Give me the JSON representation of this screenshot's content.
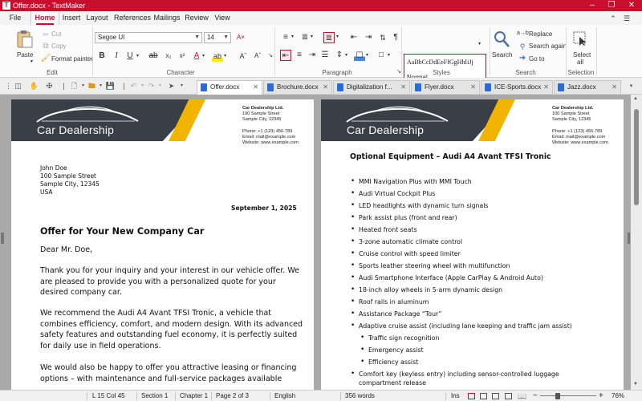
{
  "window": {
    "title": "Offer.docx - TextMaker",
    "app_icon": "T",
    "controls": [
      "–",
      "❐",
      "✕"
    ]
  },
  "menu": {
    "tabs": [
      "File",
      "Home",
      "Insert",
      "Layout",
      "References",
      "Mailings",
      "Review",
      "View"
    ],
    "active": "Home"
  },
  "ribbon": {
    "edit": {
      "paste": "Paste",
      "cut": "Cut",
      "copy": "Copy",
      "format_painter": "Format painter",
      "label": "Edit"
    },
    "character": {
      "font": "Segoe UI",
      "size": "14",
      "label": "Character"
    },
    "paragraph": {
      "label": "Paragraph"
    },
    "styles": {
      "preview": "AaBbCcDdEeFfGgHhIiJj",
      "current": "Normal",
      "label": "Styles"
    },
    "search": {
      "search": "Search",
      "replace": "Replace",
      "search_again": "Search again",
      "goto": "Go to",
      "label": "Search"
    },
    "selection": {
      "select_all_1": "Select",
      "select_all_2": "all",
      "label": "Selection"
    }
  },
  "doc_tabs": [
    "Offer.docx",
    "Brochure.docx",
    "Digitalization f...",
    "Flyer.docx",
    "ICE-Sports.docx",
    "Jazz.docx"
  ],
  "active_doc": "Offer.docx",
  "letterhead": {
    "logo": "Car Dealership",
    "company": "Car Dealership Ltd.",
    "street": "100 Sample Street",
    "city": "Sample City, 12345",
    "phone": "Phone: +1 (123) 456-789",
    "email": "Email: mail@example.com",
    "website": "Website: www.example.com"
  },
  "page1": {
    "recipient": [
      "John Doe",
      "100 Sample Street",
      "Sample City, 12345",
      "USA"
    ],
    "date": "September 1, 2025",
    "heading": "Offer for Your New Company Car",
    "salutation": "Dear Mr. Doe,",
    "p1": [
      "Thank you for your inquiry and your interest in our vehicle offer. We",
      "are pleased to provide you with a personalized quote for your",
      "desired company car."
    ],
    "p2": [
      "We recommend the Audi A4 Avant TFSI Tronic, a vehicle that",
      "combines efficiency, comfort, and modern design. With its advanced",
      "safety features and outstanding fuel economy, it is perfectly suited",
      "for daily use in field operations."
    ],
    "p3": [
      "We would also be happy to offer you attractive leasing or financing",
      "options – with maintenance and full-service packages available"
    ]
  },
  "page2": {
    "heading": "Optional Equipment – Audi A4 Avant TFSI Tronic",
    "items": [
      "MMI Navigation Plus with MMI Touch",
      "Audi Virtual Cockpit Plus",
      "LED headlights with dynamic turn signals",
      "Park assist plus (front and rear)",
      "Heated front seats",
      "3-zone automatic climate control",
      "Cruise control with speed limiter",
      "Sports leather steering wheel with multifunction",
      "Audi Smartphone Interface (Apple CarPlay & Android Auto)",
      "18-inch alloy wheels in 5-arm dynamic design",
      "Roof rails in aluminum",
      "Assistance Package “Tour”",
      "Adaptive cruise assist (including lane keeping and traffic jam assist)"
    ],
    "subitems": [
      "Traffic sign recognition",
      "Emergency assist",
      "Efficiency assist"
    ],
    "last_item": [
      "Comfort key (keyless entry) including sensor-controlled luggage",
      "compartment release"
    ]
  },
  "status": {
    "position": "L 15 Col 45",
    "section": "Section 1",
    "chapter": "Chapter 1",
    "page": "Page 2 of 3",
    "language": "English",
    "words": "356 words",
    "mode": "Ins",
    "zoom": "76%"
  },
  "colors": {
    "accent": "#c8102e",
    "header_dark": "#3a3f47",
    "header_yellow": "#f1b400"
  }
}
